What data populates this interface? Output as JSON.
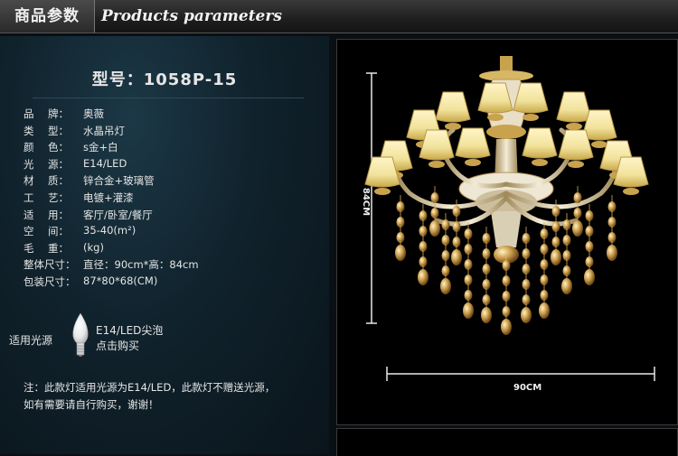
{
  "header": {
    "title_cn": "商品参数",
    "title_en": "Products parameters"
  },
  "model": "型号：1058P-15",
  "specs": [
    {
      "label": "品牌",
      "value": "奥薇"
    },
    {
      "label": "类型",
      "value": "水晶吊灯"
    },
    {
      "label": "颜色",
      "value": "s金+白"
    },
    {
      "label": "光源",
      "value": "E14/LED"
    },
    {
      "label": "材质",
      "value": "锌合金+玻璃管"
    },
    {
      "label": "工艺",
      "value": "电镀+灌漆"
    },
    {
      "label": "适用",
      "value": "客厅/卧室/餐厅"
    },
    {
      "label": "空间",
      "value": "35-40(m²)"
    },
    {
      "label": "毛重",
      "value": "(kg)"
    },
    {
      "label": "整体尺寸",
      "value": "直径：90cm*高：84cm"
    },
    {
      "label": "包装尺寸",
      "value": "87*80*68(CM)"
    }
  ],
  "bulb": {
    "label": "适用光源",
    "line1": "E14/LED尖泡",
    "line2": "点击购买"
  },
  "note": {
    "line1": "注：此款灯适用光源为E14/LED，此款灯不赠送光源，",
    "line2": "如有需要请自行购买，谢谢！"
  },
  "dimensions": {
    "height": "84CM",
    "width": "90CM"
  },
  "colors": {
    "background": "#0a0f14",
    "panel": "#10222c",
    "gold": "#d8b060",
    "shade": "#f3e6a8"
  }
}
